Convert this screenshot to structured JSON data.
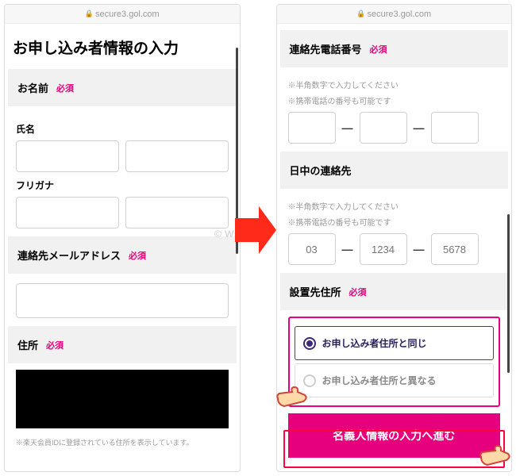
{
  "url": "secure3.gol.com",
  "left": {
    "title": "お申し込み者情報の入力",
    "name_section": "お名前",
    "required": "必須",
    "fullname_label": "氏名",
    "furigana_label": "フリガナ",
    "email_section": "連絡先メールアドレス",
    "address_section": "住所",
    "address_note": "※楽天会員IDに登録されている住所を表示しています。"
  },
  "right": {
    "phone_section": "連絡先電話番号",
    "required": "必須",
    "hint1": "※半角数字で入力してください",
    "hint2": "※携帯電話の番号も可能です",
    "daytime_section": "日中の連絡先",
    "ph1": "03",
    "ph2": "1234",
    "ph3": "5678",
    "install_section": "設置先住所",
    "radio_same": "お申し込み者住所と同じ",
    "radio_diff": "お申し込み者住所と異なる",
    "cta": "名義人情報の入力へ進む"
  },
  "watermark": "© Wi-Fiの森"
}
